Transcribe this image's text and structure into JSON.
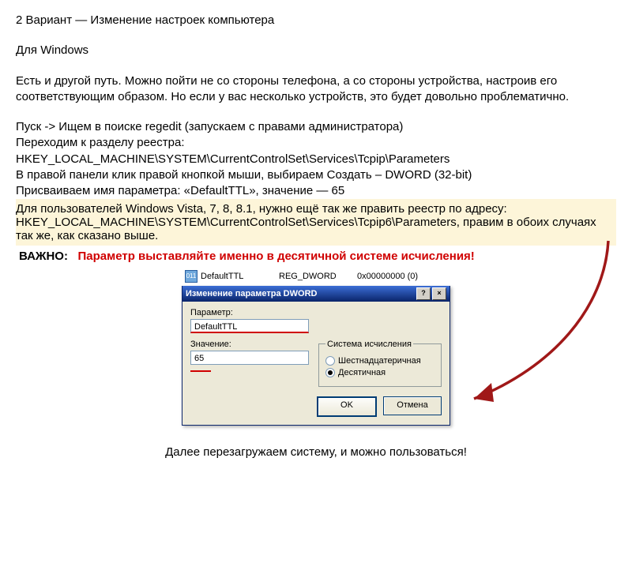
{
  "article": {
    "heading": "2 Вариант — Изменение настроек компьютера",
    "os": "Для Windows",
    "intro": "Есть и другой путь. Можно пойти не со стороны телефона, а со стороны устройства, настроив его соответствующим образом. Но если у вас несколько устройств, это будет довольно проблематично.",
    "step1": "Пуск -> Ищем в поиске regedit (запускаем с правами администратора)",
    "step2": "Переходим к разделу реестра:",
    "regpath1": "HKEY_LOCAL_MACHINE\\SYSTEM\\CurrentControlSet\\Services\\Tcpip\\Parameters",
    "step3": "В правой панели клик правой кнопкой мыши, выбираем Создать – DWORD (32-bit)",
    "step4": "Присваиваем имя параметра: «DefaultTTL»,  значение — 65",
    "vistaNote1": "Для пользователей Windows Vista, 7, 8, 8.1, нужно ещё так же править реестр по адресу:",
    "regpath2": "HKEY_LOCAL_MACHINE\\SYSTEM\\CurrentControlSet\\Services\\Tcpip6\\Parameters, правим в обоих случаях так же, как сказано выше.",
    "importantLabel": "ВАЖНО:",
    "importantText": "Параметр выставляйте именно в десятичной системе исчисления!",
    "footer": "Далее перезагружаем систему, и можно пользоваться!"
  },
  "registryRow": {
    "name": "DefaultTTL",
    "type": "REG_DWORD",
    "data": "0x00000000 (0)"
  },
  "dialog": {
    "title": "Изменение параметра DWORD",
    "helpBtn": "?",
    "closeBtn": "×",
    "paramLabel": "Параметр:",
    "paramValue": "DefaultTTL",
    "valueLabel": "Значение:",
    "valueValue": "65",
    "radixLegend": "Система исчисления",
    "hexLabel": "Шестнадцатеричная",
    "decLabel": "Десятичная",
    "ok": "OK",
    "cancel": "Отмена"
  }
}
